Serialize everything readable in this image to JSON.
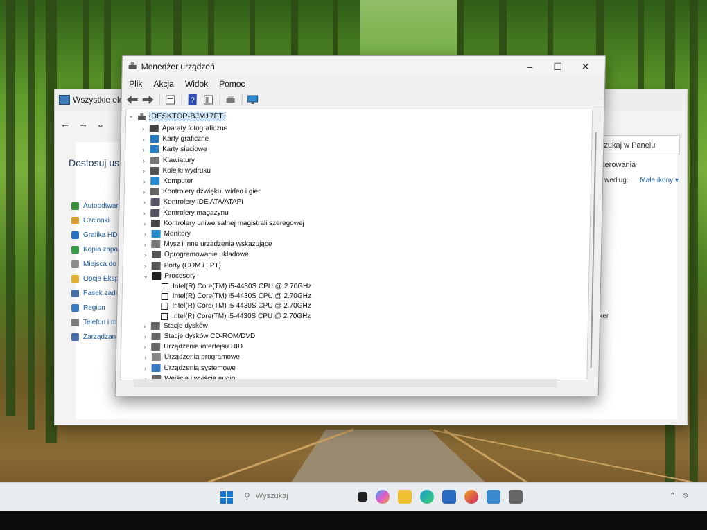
{
  "control_panel": {
    "title": "Wszystkie elem",
    "heading": "Dostosuj usta",
    "search_placeholder": "Szukaj w Panelu sterowania",
    "view_by_label": "dok według:",
    "view_by_value": "Małe ikony",
    "bitlocker_text": "zja BitLocker",
    "items": [
      {
        "label": "Autoodtwarzar",
        "color": "#3a8f3a"
      },
      {
        "label": "Czcionki",
        "color": "#d6a22a"
      },
      {
        "label": "Grafika HD Inte",
        "color": "#2a6fc0"
      },
      {
        "label": "Kopia zapasow",
        "color": "#3a9a4a"
      },
      {
        "label": "Miejsca do ma",
        "color": "#8a8a8a"
      },
      {
        "label": "Opcje Eksplora",
        "color": "#e0b030"
      },
      {
        "label": "Pasek zadań i r",
        "color": "#4a6fa8"
      },
      {
        "label": "Region",
        "color": "#3a7ac0"
      },
      {
        "label": "Telefon i mode",
        "color": "#7a7a7a"
      },
      {
        "label": "Zarządzanie ko",
        "color": "#4a6fa8"
      }
    ]
  },
  "device_manager": {
    "title": "Menedżer urządzeń",
    "menu": [
      "Plik",
      "Akcja",
      "Widok",
      "Pomoc"
    ],
    "root": "DESKTOP-BJM17FT",
    "categories": [
      {
        "label": "Aparaty fotograficzne",
        "icon": "camera-icon",
        "color": "#444"
      },
      {
        "label": "Karty graficzne",
        "icon": "display-adapter-icon",
        "color": "#2a7ac0"
      },
      {
        "label": "Karty sieciowe",
        "icon": "network-icon",
        "color": "#2a7ac0"
      },
      {
        "label": "Klawiatury",
        "icon": "keyboard-icon",
        "color": "#777"
      },
      {
        "label": "Kolejki wydruku",
        "icon": "printer-icon",
        "color": "#555"
      },
      {
        "label": "Komputer",
        "icon": "computer-icon",
        "color": "#2a8ad0"
      },
      {
        "label": "Kontrolery dźwięku, wideo i gier",
        "icon": "speaker-icon",
        "color": "#666"
      },
      {
        "label": "Kontrolery IDE ATA/ATAPI",
        "icon": "ide-icon",
        "color": "#556"
      },
      {
        "label": "Kontrolery magazynu",
        "icon": "storage-icon",
        "color": "#556"
      },
      {
        "label": "Kontrolery uniwersalnej magistrali szeregowej",
        "icon": "usb-icon",
        "color": "#444"
      },
      {
        "label": "Monitory",
        "icon": "monitor-icon",
        "color": "#2a8ad0"
      },
      {
        "label": "Mysz i inne urządzenia wskazujące",
        "icon": "mouse-icon",
        "color": "#777"
      },
      {
        "label": "Oprogramowanie układowe",
        "icon": "firmware-icon",
        "color": "#555"
      },
      {
        "label": "Porty (COM i LPT)",
        "icon": "port-icon",
        "color": "#555"
      },
      {
        "label": "Procesory",
        "icon": "cpu-icon",
        "color": "#222",
        "expanded": true
      },
      {
        "label": "Stacje dysków",
        "icon": "disk-icon",
        "color": "#666"
      },
      {
        "label": "Stacje dysków CD-ROM/DVD",
        "icon": "cdrom-icon",
        "color": "#666"
      },
      {
        "label": "Urządzenia interfejsu HID",
        "icon": "hid-icon",
        "color": "#666"
      },
      {
        "label": "Urządzenia programowe",
        "icon": "software-device-icon",
        "color": "#888"
      },
      {
        "label": "Urządzenia systemowe",
        "icon": "system-device-icon",
        "color": "#3a7ac0"
      },
      {
        "label": "Wejścia i wyjścia audio",
        "icon": "audio-io-icon",
        "color": "#666"
      }
    ],
    "processors": [
      "Intel(R) Core(TM) i5-4430S CPU @ 2.70GHz",
      "Intel(R) Core(TM) i5-4430S CPU @ 2.70GHz",
      "Intel(R) Core(TM) i5-4430S CPU @ 2.70GHz",
      "Intel(R) Core(TM) i5-4430S CPU @ 2.70GHz"
    ]
  },
  "taskbar": {
    "search_placeholder": "Wyszukaj"
  }
}
